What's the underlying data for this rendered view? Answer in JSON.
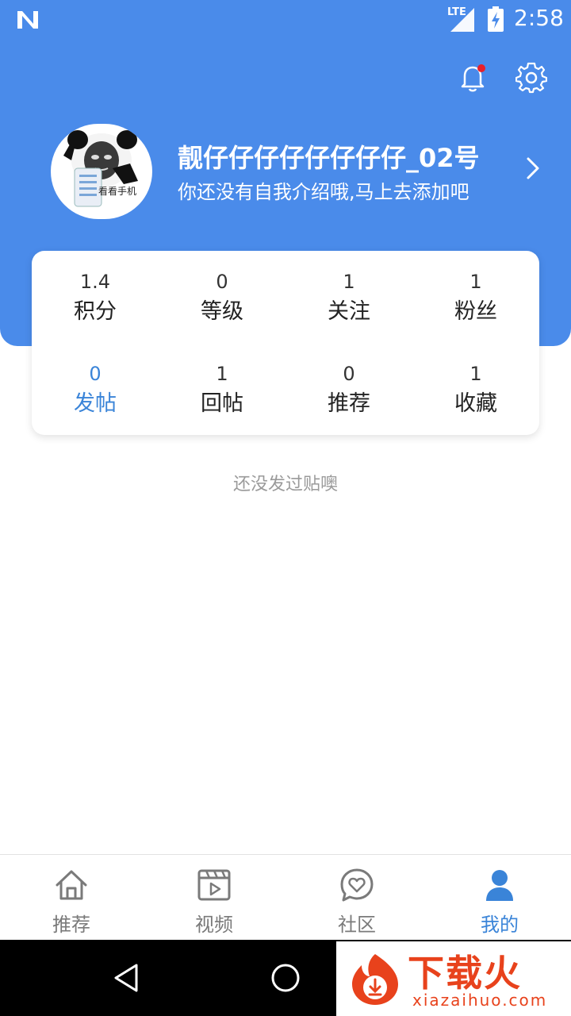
{
  "status_bar": {
    "network": "LTE",
    "time": "2:58",
    "battery_icon": "battery-charging-icon",
    "app_logo_icon": "n-logo-icon"
  },
  "header": {
    "notification_icon": "bell-icon",
    "notification_badge_color": "#e8202a",
    "settings_icon": "gear-icon",
    "background_color": "#4a8bea"
  },
  "profile": {
    "avatar_caption": "看看手机",
    "username": "靓仔仔仔仔仔仔仔仔_02号",
    "bio": "你还没有自我介绍哦,马上去添加吧",
    "chevron_icon": "chevron-right-icon"
  },
  "stats": [
    {
      "value": "1.4",
      "label": "积分"
    },
    {
      "value": "0",
      "label": "等级"
    },
    {
      "value": "1",
      "label": "关注"
    },
    {
      "value": "1",
      "label": "粉丝"
    },
    {
      "value": "0",
      "label": "发帖",
      "active": true
    },
    {
      "value": "1",
      "label": "回帖"
    },
    {
      "value": "0",
      "label": "推荐"
    },
    {
      "value": "1",
      "label": "收藏"
    }
  ],
  "empty_message": "还没发过贴噢",
  "tabs": [
    {
      "label": "推荐",
      "icon": "home-icon"
    },
    {
      "label": "视频",
      "icon": "video-icon"
    },
    {
      "label": "社区",
      "icon": "heart-chat-icon"
    },
    {
      "label": "我的",
      "icon": "user-icon",
      "active": true
    }
  ],
  "accent_color": "#3a84d8",
  "watermark": {
    "title": "下载火",
    "subtitle": "xiazaihuo.com"
  }
}
